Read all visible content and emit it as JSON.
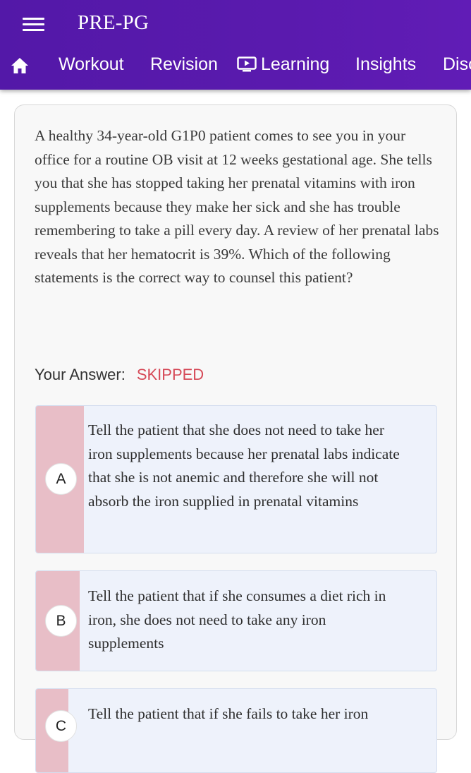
{
  "header": {
    "title": "PRE-PG",
    "nav": [
      "Workout",
      "Revision",
      "Learning",
      "Insights",
      "Disc"
    ]
  },
  "question": {
    "text": "A healthy 34-year-old G1P0 patient comes to see you in your office for a routine OB visit at 12 weeks gestational age. She tells you that she has stopped taking her prenatal vitamins with iron supplements because they make her sick and she has trouble remembering to take a pill every day. A review of her prenatal labs reveals that her hematocrit is 39%. Which of the following statements is the correct way to counsel this patient?"
  },
  "answer": {
    "label": "Your Answer:",
    "value": "SKIPPED"
  },
  "options": [
    {
      "letter": "A",
      "text": "Tell the patient that she does not need to take her iron supplements because her prenatal labs indicate that she is not anemic and therefore she will not absorb the iron supplied in prenatal vitamins"
    },
    {
      "letter": "B",
      "text": "Tell the patient that if she consumes a diet rich in iron, she does not need to take any iron supplements"
    },
    {
      "letter": "C",
      "text": "Tell the patient that if she fails to take her iron"
    }
  ],
  "colors": {
    "header_bg": "#5a1aae",
    "skipped": "#d64a58",
    "option_strip": "#e8bec7",
    "option_bg": "#eef2fb"
  },
  "icons": [
    "menu-icon",
    "home-icon",
    "learning-screen-icon"
  ]
}
